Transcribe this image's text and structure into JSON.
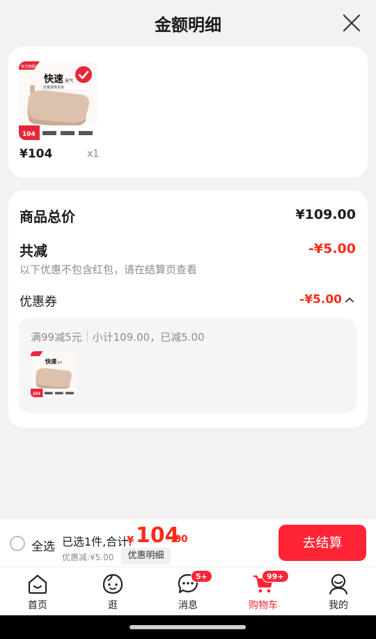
{
  "header": {
    "title": "金额明细"
  },
  "item": {
    "price": "¥104",
    "qty": "x1",
    "image": {
      "tag": "官方旗舰店",
      "headline": "快速",
      "sub": "充气",
      "line": "轻量便携实用",
      "price": "104"
    }
  },
  "summary": {
    "total_label": "商品总价",
    "total_value": "¥109.00",
    "reduce_label": "共减",
    "reduce_value": "-¥5.00",
    "note": "以下优惠不包含红包，请在结算页查看",
    "coupon_label": "优惠券",
    "coupon_value": "-¥5.00"
  },
  "coupon_detail": {
    "rule": "满99减5元",
    "subtotal": "小计109.00，已减5.00"
  },
  "bottom": {
    "select_all": "全选",
    "selected": "已选1件,合计:",
    "currency": "¥",
    "total_int": "104",
    "total_dec": ".00",
    "discount": "优惠减:¥5.00",
    "detail_button": "优惠明细",
    "checkout": "去结算"
  },
  "tabs": [
    {
      "label": "首页",
      "icon": "home-icon"
    },
    {
      "label": "逛",
      "icon": "stroll-icon"
    },
    {
      "label": "消息",
      "icon": "message-icon",
      "badge": "5+"
    },
    {
      "label": "购物车",
      "icon": "cart-icon",
      "badge": "99+",
      "active": true
    },
    {
      "label": "我的",
      "icon": "profile-icon"
    }
  ],
  "colors": {
    "accent": "#ff2536",
    "price": "#ff2a1a",
    "text": "#1a1a1a",
    "muted": "#8c8c8c",
    "background": "#f2f2f2"
  }
}
